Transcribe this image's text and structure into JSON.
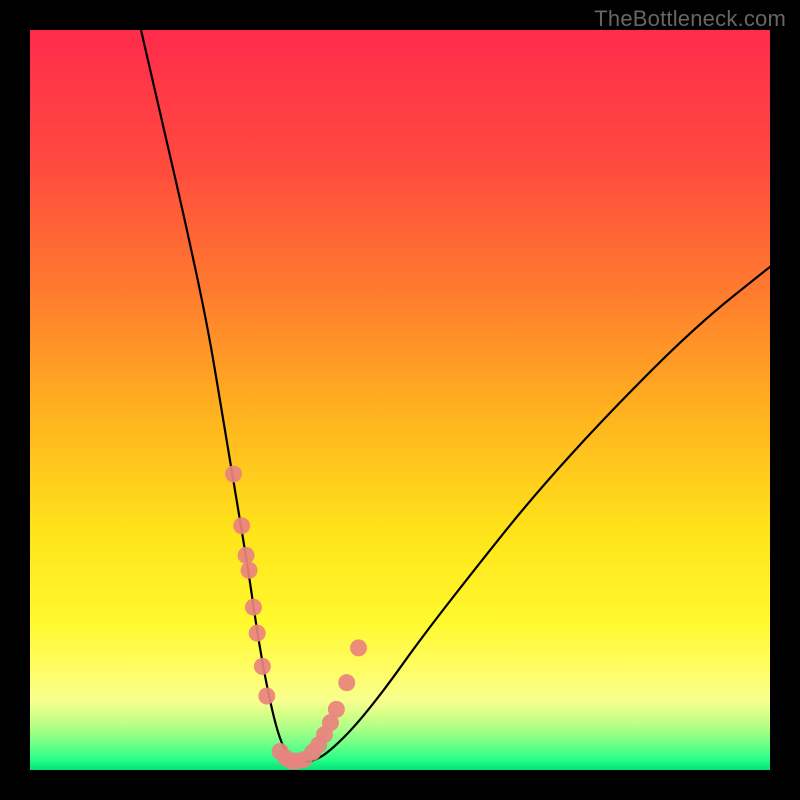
{
  "watermark": "TheBottleneck.com",
  "chart_data": {
    "type": "line",
    "title": "",
    "xlabel": "",
    "ylabel": "",
    "xlim": [
      0,
      100
    ],
    "ylim": [
      0,
      100
    ],
    "series": [
      {
        "name": "curve",
        "x": [
          15,
          18,
          21,
          24,
          26,
          28,
          29.5,
          30.5,
          31.5,
          32.5,
          33.5,
          34.5,
          35.5,
          37,
          39,
          41,
          44,
          48,
          53,
          60,
          68,
          78,
          90,
          100
        ],
        "y": [
          100,
          87,
          74,
          60,
          48,
          36,
          27,
          20,
          14,
          9,
          5,
          2.5,
          1.2,
          1.0,
          1.5,
          3,
          6,
          11,
          18,
          27,
          37,
          48,
          60,
          68
        ]
      }
    ],
    "markers": {
      "name": "dots",
      "x": [
        27.5,
        28.6,
        29.2,
        29.6,
        30.2,
        30.7,
        31.4,
        32.0,
        33.8,
        34.6,
        35.4,
        36.0,
        37.0,
        38.2,
        39.0,
        39.8,
        40.6,
        41.4,
        42.8,
        44.4
      ],
      "y": [
        40,
        33,
        29,
        27,
        22,
        18.5,
        14,
        10,
        2.5,
        1.6,
        1.2,
        1.2,
        1.4,
        2.4,
        3.4,
        4.8,
        6.4,
        8.2,
        11.8,
        16.5
      ]
    },
    "gradient_stops": [
      {
        "offset": 0.0,
        "color": "#ff2b4b"
      },
      {
        "offset": 0.18,
        "color": "#ff4a3e"
      },
      {
        "offset": 0.35,
        "color": "#ff7a2f"
      },
      {
        "offset": 0.52,
        "color": "#ffb31f"
      },
      {
        "offset": 0.68,
        "color": "#ffe41a"
      },
      {
        "offset": 0.8,
        "color": "#fff92e"
      },
      {
        "offset": 0.87,
        "color": "#fffd6a"
      },
      {
        "offset": 0.905,
        "color": "#f8ff8e"
      },
      {
        "offset": 0.925,
        "color": "#d6ff88"
      },
      {
        "offset": 0.945,
        "color": "#a8ff86"
      },
      {
        "offset": 0.965,
        "color": "#6fff87"
      },
      {
        "offset": 0.985,
        "color": "#2bff88"
      },
      {
        "offset": 1.0,
        "color": "#00e37a"
      }
    ]
  }
}
